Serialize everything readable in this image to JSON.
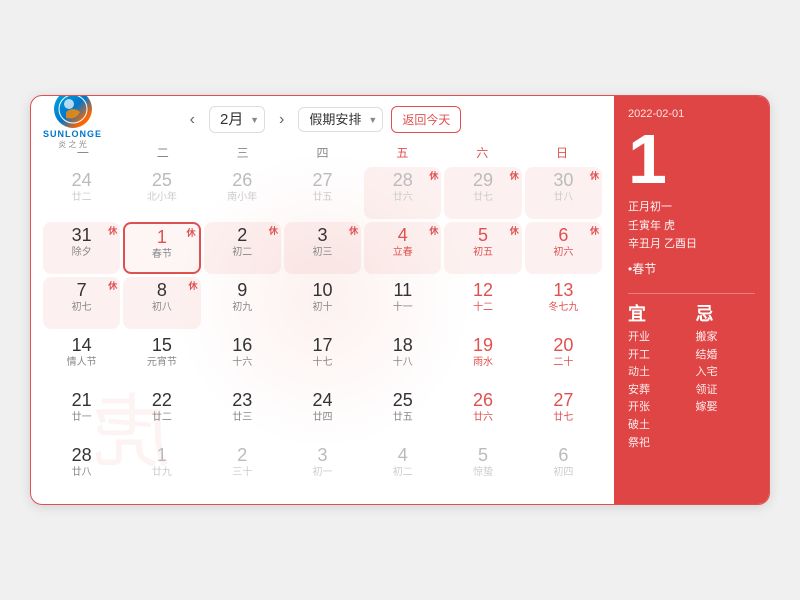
{
  "logo": {
    "text": "SUNLONGE",
    "sub": "炎 之 光"
  },
  "header": {
    "prev_label": "‹",
    "next_label": "›",
    "month_value": "2月",
    "holiday_label": "假期安排",
    "return_label": "返回今天"
  },
  "weekdays": [
    "一",
    "二",
    "三",
    "四",
    "五",
    "六",
    "日"
  ],
  "sidebar": {
    "date_str": "2022-02-01",
    "day_big": "1",
    "lunar_line1": "正月初一",
    "lunar_line2": "壬寅年 虎",
    "lunar_line3": "辛丑月 乙酉日",
    "festival": "•春节",
    "yi_header": "宜",
    "ji_header": "忌",
    "yi_items": [
      "开业",
      "开工",
      "动土",
      "安葬",
      "开张",
      "破土",
      "祭祀"
    ],
    "ji_items": [
      "搬家",
      "结婚",
      "入宅",
      "领证",
      "嫁娶"
    ]
  },
  "rows": [
    [
      {
        "num": "24",
        "lunar": "廿二",
        "faded": true,
        "holiday": "",
        "weekend": false,
        "bg": false
      },
      {
        "num": "25",
        "lunar": "北小年",
        "faded": true,
        "holiday": "",
        "weekend": false,
        "bg": false
      },
      {
        "num": "26",
        "lunar": "南小年",
        "faded": true,
        "holiday": "",
        "weekend": false,
        "bg": false
      },
      {
        "num": "27",
        "lunar": "廿五",
        "faded": true,
        "holiday": "",
        "weekend": false,
        "bg": false
      },
      {
        "num": "28",
        "lunar": "廿六",
        "faded": true,
        "holiday": "休",
        "weekend": true,
        "bg": true
      },
      {
        "num": "29",
        "lunar": "廿七",
        "faded": true,
        "holiday": "休",
        "weekend": true,
        "bg": true
      },
      {
        "num": "30",
        "lunar": "廿八",
        "faded": true,
        "holiday": "休",
        "weekend": true,
        "bg": true
      }
    ],
    [
      {
        "num": "31",
        "lunar": "除夕",
        "faded": false,
        "holiday": "休",
        "weekend": false,
        "bg": true
      },
      {
        "num": "1",
        "lunar": "春节",
        "faded": false,
        "holiday": "休",
        "weekend": false,
        "bg": false,
        "selected": true
      },
      {
        "num": "2",
        "lunar": "初二",
        "faded": false,
        "holiday": "休",
        "weekend": false,
        "bg": true
      },
      {
        "num": "3",
        "lunar": "初三",
        "faded": false,
        "holiday": "休",
        "weekend": false,
        "bg": true
      },
      {
        "num": "4",
        "lunar": "立春",
        "faded": false,
        "holiday": "休",
        "weekend": true,
        "bg": true
      },
      {
        "num": "5",
        "lunar": "初五",
        "faded": false,
        "holiday": "休",
        "weekend": true,
        "bg": true
      },
      {
        "num": "6",
        "lunar": "初六",
        "faded": false,
        "holiday": "休",
        "weekend": true,
        "bg": true
      }
    ],
    [
      {
        "num": "7",
        "lunar": "初七",
        "faded": false,
        "holiday": "休",
        "weekend": false,
        "bg": true
      },
      {
        "num": "8",
        "lunar": "初八",
        "faded": false,
        "holiday": "休",
        "weekend": false,
        "bg": true
      },
      {
        "num": "9",
        "lunar": "初九",
        "faded": false,
        "holiday": "",
        "weekend": false,
        "bg": false
      },
      {
        "num": "10",
        "lunar": "初十",
        "faded": false,
        "holiday": "",
        "weekend": false,
        "bg": false
      },
      {
        "num": "11",
        "lunar": "十一",
        "faded": false,
        "holiday": "",
        "weekend": false,
        "bg": false
      },
      {
        "num": "12",
        "lunar": "十二",
        "faded": false,
        "holiday": "",
        "weekend": true,
        "bg": false
      },
      {
        "num": "13",
        "lunar": "冬七九",
        "faded": false,
        "holiday": "",
        "weekend": true,
        "bg": false
      }
    ],
    [
      {
        "num": "14",
        "lunar": "情人节",
        "faded": false,
        "holiday": "",
        "weekend": false,
        "bg": false
      },
      {
        "num": "15",
        "lunar": "元宵节",
        "faded": false,
        "holiday": "",
        "weekend": false,
        "bg": false
      },
      {
        "num": "16",
        "lunar": "十六",
        "faded": false,
        "holiday": "",
        "weekend": false,
        "bg": false
      },
      {
        "num": "17",
        "lunar": "十七",
        "faded": false,
        "holiday": "",
        "weekend": false,
        "bg": false
      },
      {
        "num": "18",
        "lunar": "十八",
        "faded": false,
        "holiday": "",
        "weekend": false,
        "bg": false
      },
      {
        "num": "19",
        "lunar": "雨水",
        "faded": false,
        "holiday": "",
        "weekend": true,
        "bg": false,
        "red": true
      },
      {
        "num": "20",
        "lunar": "二十",
        "faded": false,
        "holiday": "",
        "weekend": true,
        "bg": false,
        "red": true
      }
    ],
    [
      {
        "num": "21",
        "lunar": "廿一",
        "faded": false,
        "holiday": "",
        "weekend": false,
        "bg": false
      },
      {
        "num": "22",
        "lunar": "廿二",
        "faded": false,
        "holiday": "",
        "weekend": false,
        "bg": false
      },
      {
        "num": "23",
        "lunar": "廿三",
        "faded": false,
        "holiday": "",
        "weekend": false,
        "bg": false
      },
      {
        "num": "24",
        "lunar": "廿四",
        "faded": false,
        "holiday": "",
        "weekend": false,
        "bg": false
      },
      {
        "num": "25",
        "lunar": "廿五",
        "faded": false,
        "holiday": "",
        "weekend": false,
        "bg": false
      },
      {
        "num": "26",
        "lunar": "廿六",
        "faded": false,
        "holiday": "",
        "weekend": true,
        "bg": false,
        "red": true
      },
      {
        "num": "27",
        "lunar": "廿七",
        "faded": false,
        "holiday": "",
        "weekend": true,
        "bg": false
      }
    ],
    [
      {
        "num": "28",
        "lunar": "廿八",
        "faded": false,
        "holiday": "",
        "weekend": false,
        "bg": false
      },
      {
        "num": "1",
        "lunar": "廿九",
        "faded": true,
        "holiday": "",
        "weekend": false,
        "bg": false
      },
      {
        "num": "2",
        "lunar": "三十",
        "faded": true,
        "holiday": "",
        "weekend": false,
        "bg": false
      },
      {
        "num": "3",
        "lunar": "初一",
        "faded": true,
        "holiday": "",
        "weekend": false,
        "bg": false
      },
      {
        "num": "4",
        "lunar": "初二",
        "faded": true,
        "holiday": "",
        "weekend": false,
        "bg": false
      },
      {
        "num": "5",
        "lunar": "惊蛰",
        "faded": true,
        "holiday": "",
        "weekend": true,
        "bg": false,
        "red": true
      },
      {
        "num": "6",
        "lunar": "初四",
        "faded": true,
        "holiday": "",
        "weekend": true,
        "bg": false,
        "red": true
      }
    ]
  ]
}
